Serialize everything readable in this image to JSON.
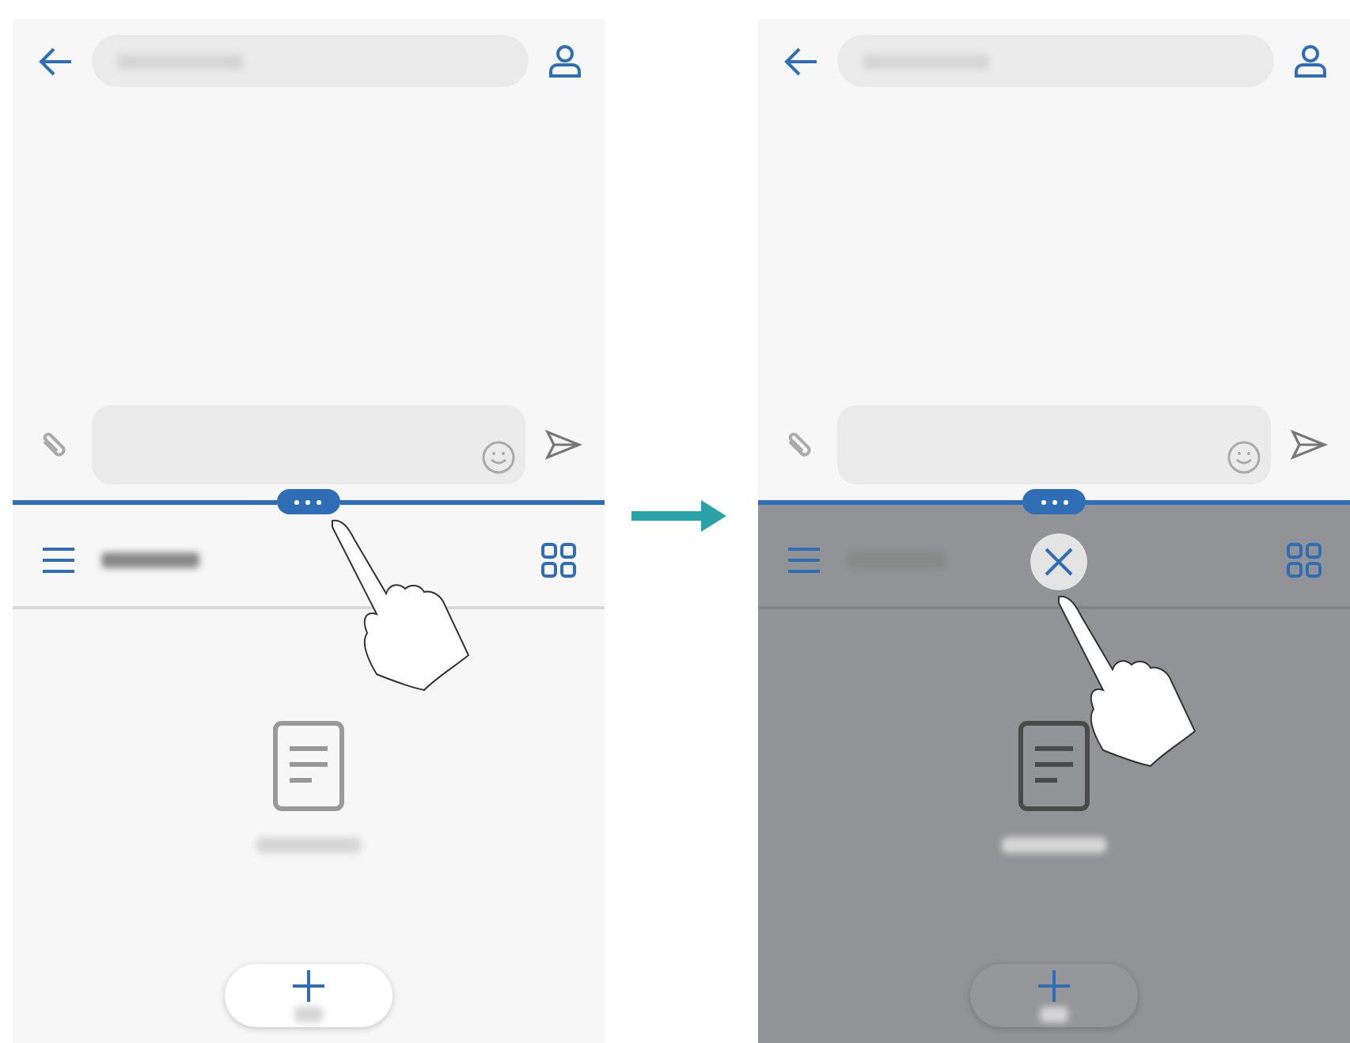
{
  "screens": [
    {
      "bottom_dimmed": false,
      "close_button": false
    },
    {
      "bottom_dimmed": true,
      "close_button": true
    }
  ]
}
